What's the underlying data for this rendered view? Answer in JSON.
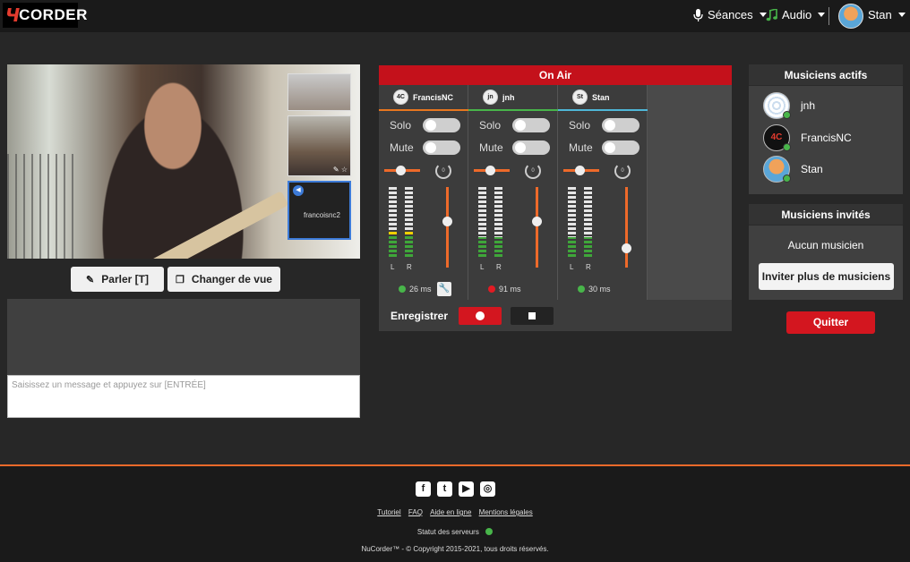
{
  "brand": {
    "logo_mark": "Ч",
    "logo_word": "CORDER"
  },
  "nav": {
    "sessions_label": "Séances",
    "audio_label": "Audio",
    "user_name": "Stan"
  },
  "video": {
    "thumb3_label": "francoisnc2"
  },
  "controls": {
    "talk_label": "Parler [T]",
    "view_label": "Changer de vue"
  },
  "chat": {
    "placeholder": "Saisissez un message et appuyez sur [ENTRÉE]"
  },
  "mixer": {
    "on_air_label": "On Air",
    "solo_label": "Solo",
    "mute_label": "Mute",
    "left_label": "L",
    "right_label": "R",
    "pan_dial_value": "0",
    "channels": [
      {
        "name": "FrancisNC",
        "avatar": "4C",
        "accent": "#e8771f",
        "latency": "26 ms",
        "status_color": "#48b54a",
        "fader_level": 0.55
      },
      {
        "name": "jnh",
        "avatar": "jn",
        "accent": "#48b54a",
        "latency": "91 ms",
        "status_color": "#e31b23",
        "fader_level": 0.55
      },
      {
        "name": "Stan",
        "avatar": "St",
        "accent": "#4fb7d8",
        "latency": "30 ms",
        "status_color": "#48b54a",
        "fader_level": 0.2
      }
    ],
    "record_label": "Enregistrer"
  },
  "active_musicians": {
    "title": "Musiciens actifs",
    "items": [
      {
        "name": "jnh"
      },
      {
        "name": "FrancisNC"
      },
      {
        "name": "Stan"
      }
    ]
  },
  "invited_musicians": {
    "title": "Musiciens invités",
    "empty_text": "Aucun musicien",
    "invite_label": "Inviter plus de musiciens"
  },
  "quit_label": "Quitter",
  "footer": {
    "socials": [
      "facebook-icon",
      "twitter-icon",
      "youtube-icon",
      "instagram-icon"
    ],
    "links": [
      "Tutoriel",
      "FAQ",
      "Aide en ligne",
      "Mentions légales"
    ],
    "server_status_label": "Statut des serveurs",
    "copyright": "NuCorder™ - © Copyright 2015-2021, tous droits réservés."
  },
  "colors": {
    "accent_orange": "#ee6a2a",
    "brand_red": "#d3161f",
    "online_green": "#48b54a"
  }
}
